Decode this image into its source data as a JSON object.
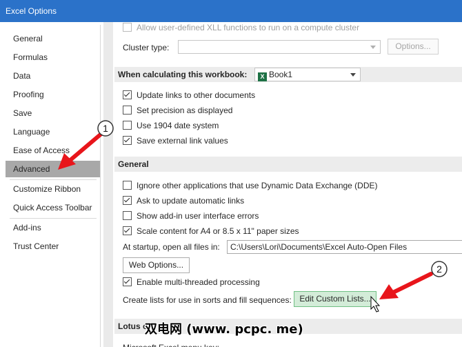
{
  "window": {
    "title": "Excel Options"
  },
  "sidebar": {
    "items": [
      {
        "label": "General"
      },
      {
        "label": "Formulas"
      },
      {
        "label": "Data"
      },
      {
        "label": "Proofing"
      },
      {
        "label": "Save"
      },
      {
        "label": "Language"
      },
      {
        "label": "Ease of Access"
      },
      {
        "label": "Advanced"
      },
      {
        "label": "Customize Ribbon"
      },
      {
        "label": "Quick Access Toolbar"
      },
      {
        "label": "Add-ins"
      },
      {
        "label": "Trust Center"
      }
    ],
    "selected": "Advanced"
  },
  "content": {
    "top_partial_label": "Allow user-defined XLL functions to run on a compute cluster",
    "cluster_type_label": "Cluster type:",
    "cluster_type_value": "",
    "options_button": "Options...",
    "calc_section_label": "When calculating this workbook:",
    "workbook_value": "Book1",
    "calc_options": [
      {
        "label": "Update links to other documents",
        "checked": true
      },
      {
        "label": "Set precision as displayed",
        "checked": false
      },
      {
        "label": "Use 1904 date system",
        "checked": false
      },
      {
        "label": "Save external link values",
        "checked": true
      }
    ],
    "general_section_label": "General",
    "general_options": [
      {
        "label": "Ignore other applications that use Dynamic Data Exchange (DDE)",
        "checked": false
      },
      {
        "label": "Ask to update automatic links",
        "checked": true
      },
      {
        "label": "Show add-in user interface errors",
        "checked": false
      },
      {
        "label": "Scale content for A4 or 8.5 x 11\" paper sizes",
        "checked": true
      }
    ],
    "startup_label": "At startup, open all files in:",
    "startup_path": "C:\\Users\\Lori\\Documents\\Excel Auto-Open Files",
    "web_options_button": "Web Options...",
    "multithread_label": "Enable multi-threaded processing",
    "multithread_checked": true,
    "custom_lists_label": "Create lists for use in sorts and fill sequences:",
    "custom_lists_button": "Edit Custom Lists...",
    "lotus_section_label": "Lotus c",
    "bottom_partial_label": "Microsoft Excel menu key:"
  },
  "callouts": [
    {
      "number": "1"
    },
    {
      "number": "2"
    }
  ],
  "colors": {
    "titlebar": "#2b72c9",
    "selected_nav": "#a8a8a8",
    "callout_arrow": "#e8151b",
    "highlight_button": "#d3ecd8"
  },
  "watermark": "双电网 (www. pcpc. me)"
}
